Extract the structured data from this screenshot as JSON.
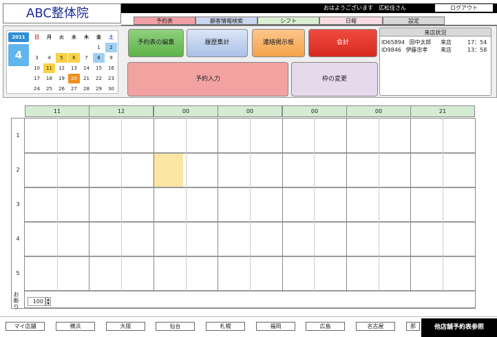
{
  "app": {
    "logo": "ABC整体院"
  },
  "header": {
    "greeting": "おはようございます　広松佳さん",
    "logout_label": "ログアウト"
  },
  "tabs": [
    {
      "label": "予約表",
      "color": "#f2a0a8"
    },
    {
      "label": "顧客情報検索",
      "color": "#c9d6ee"
    },
    {
      "label": "シフト",
      "color": "#d9eed3"
    },
    {
      "label": "日報",
      "color": "#f6dbe3"
    },
    {
      "label": "設定",
      "color": "#d8d8d8"
    }
  ],
  "calendar": {
    "year": "2011",
    "month": "4",
    "weekdays": [
      "日",
      "月",
      "火",
      "水",
      "木",
      "金",
      "土"
    ],
    "weeks": [
      [
        "",
        "",
        "",
        "",
        "",
        "1",
        "2"
      ],
      [
        "3",
        "4",
        "5",
        "6",
        "7",
        "8",
        "9"
      ],
      [
        "10",
        "11",
        "12",
        "13",
        "14",
        "15",
        "16"
      ],
      [
        "17",
        "18",
        "19",
        "20",
        "21",
        "22",
        "23"
      ],
      [
        "24",
        "25",
        "26",
        "27",
        "28",
        "29",
        "30"
      ]
    ],
    "highlight_yellow": [
      "5",
      "6",
      "11"
    ],
    "highlight_blue": [
      "2",
      "8"
    ],
    "highlight_orange": [
      "20"
    ]
  },
  "buttons": {
    "edit": "予約表の編集",
    "history": "履歴集計",
    "board": "連絡掲示板",
    "checkout": "会計",
    "reserve_input": "予約入力",
    "slot_change": "枠の変更"
  },
  "visit_status": {
    "title": "来店状況",
    "rows": [
      {
        "id": "ID65894",
        "name": "田中太郎",
        "status": "来店",
        "time": "17：54"
      },
      {
        "id": "ID9846",
        "name": "伊藤忠孝",
        "status": "来店",
        "time": "13：58"
      }
    ]
  },
  "schedule": {
    "columns": [
      "11",
      "12",
      "00",
      "00",
      "00",
      "00",
      "21"
    ],
    "rows": [
      "1",
      "2",
      "3",
      "4",
      "5"
    ],
    "refuse_label": "お断り",
    "zoom_value": "100"
  },
  "stores": [
    "マイ店舗",
    "横浜",
    "大阪",
    "仙台",
    "札幌",
    "福岡",
    "広島",
    "名古屋",
    "那"
  ],
  "other_store_label": "他店舗予約表参照"
}
